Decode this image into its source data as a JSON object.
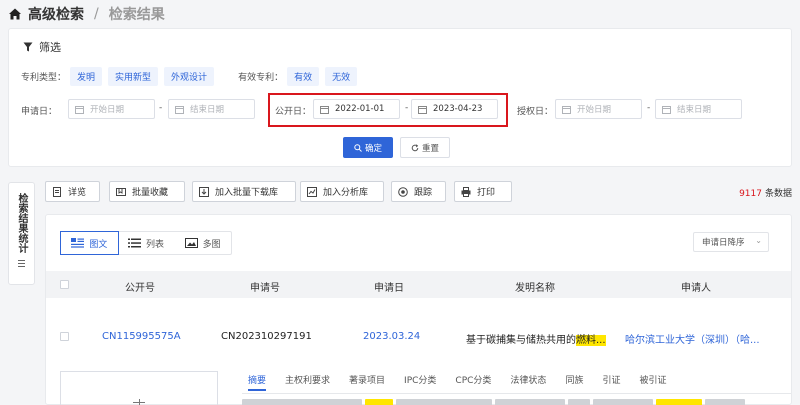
{
  "breadcrumb": {
    "home": "高级检索",
    "separator": "/",
    "current": "检索结果"
  },
  "filter": {
    "title": "筛选",
    "patent_type": {
      "label": "专利类型：",
      "options": [
        "发明",
        "实用新型",
        "外观设计"
      ]
    },
    "valid": {
      "label": "有效专利：",
      "options": [
        "有效",
        "无效"
      ]
    },
    "application_date": {
      "label": "申请日：",
      "start_placeholder": "开始日期",
      "end_placeholder": "结束日期"
    },
    "publication_date": {
      "label": "公开日：",
      "start": "2022-01-01",
      "end": "2023-04-23"
    },
    "grant_date": {
      "label": "授权日：",
      "start_placeholder": "开始日期",
      "end_placeholder": "结束日期"
    },
    "range_sep": "-",
    "confirm": "确定",
    "reset": "重置"
  },
  "sidetab": {
    "label": "检索结果统计",
    "icon": "list-icon"
  },
  "toolbar": {
    "buttons": [
      "详览",
      "批量收藏",
      "加入批量下载库",
      "加入分析库",
      "跟踪",
      "打印"
    ]
  },
  "result_count": {
    "value": "9117",
    "unit": "条数据"
  },
  "view": {
    "tabs": [
      "图文",
      "列表",
      "多图"
    ],
    "active": "图文"
  },
  "sort": {
    "label": "申请日降序"
  },
  "table": {
    "headers": [
      "公开号",
      "申请号",
      "申请日",
      "发明名称",
      "申请人"
    ],
    "rows": [
      {
        "pub_no": "CN115995575A",
        "app_no": "CN202310297191",
        "app_date": "2023.03.24",
        "title_prefix": "基于碳捕集与储热共用的",
        "title_highlight": "燃料...",
        "applicant": "哈尔滨工业大学（深圳）（哈..."
      }
    ]
  },
  "detail_tabs": [
    "摘要",
    "主权利要求",
    "著录项目",
    "IPC分类",
    "CPC分类",
    "法律状态",
    "同族",
    "引证",
    "被引证"
  ],
  "colors": {
    "accent": "#2f65d8",
    "highlight": "#ffe600",
    "alert_box": "#d9161d",
    "count": "#d9161d"
  }
}
